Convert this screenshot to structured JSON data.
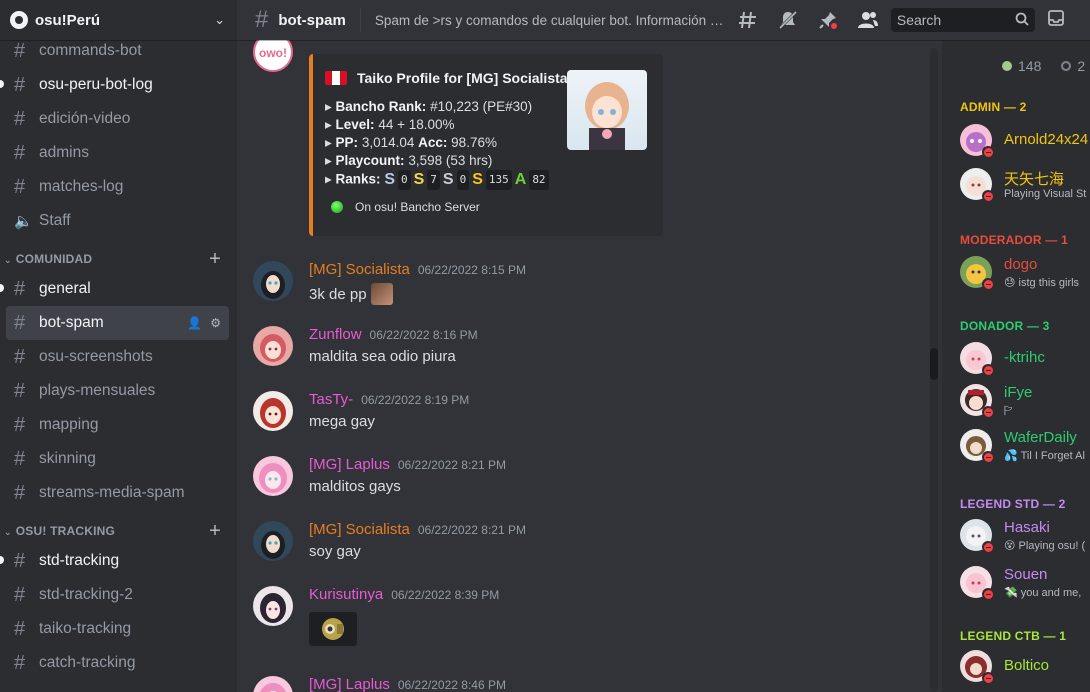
{
  "server": {
    "name": "osu!Perú"
  },
  "channels_top": [
    {
      "label": "commands-bot",
      "unread": false,
      "type": "text"
    },
    {
      "label": "osu-peru-bot-log",
      "unread": true,
      "type": "text"
    },
    {
      "label": "edición-video",
      "unread": false,
      "type": "text"
    },
    {
      "label": "admins",
      "unread": false,
      "type": "text"
    },
    {
      "label": "matches-log",
      "unread": false,
      "type": "text"
    },
    {
      "label": "Staff",
      "unread": false,
      "type": "voice"
    }
  ],
  "category_comunidad": "COMUNIDAD",
  "channels_comunidad": [
    {
      "label": "general",
      "unread": true
    },
    {
      "label": "bot-spam",
      "active": true
    },
    {
      "label": "osu-screenshots"
    },
    {
      "label": "plays-mensuales"
    },
    {
      "label": "mapping"
    },
    {
      "label": "skinning"
    },
    {
      "label": "streams-media-spam"
    }
  ],
  "category_tracking": "OSU! TRACKING",
  "channels_tracking": [
    {
      "label": "std-tracking",
      "unread": true
    },
    {
      "label": "std-tracking-2"
    },
    {
      "label": "taiko-tracking"
    },
    {
      "label": "catch-tracking"
    }
  ],
  "topbar": {
    "channel": "bot-spam",
    "topic": "Spam de >rs y comandos de cualquier bot. Información a...",
    "search_placeholder": "Search"
  },
  "embed": {
    "title": "Taiko Profile for [MG] Socialista",
    "lines": [
      {
        "k": "Bancho Rank:",
        "v": "#10,223 (PE#30)"
      },
      {
        "k": "Level:",
        "v": "44 + 18.00%"
      },
      {
        "k": "PP:",
        "v": "3,014.04",
        "k2": "Acc:",
        "v2": "98.76%"
      },
      {
        "k": "Playcount:",
        "v": "3,598 (53 hrs)"
      }
    ],
    "ranks_label": "Ranks:",
    "ranks": [
      {
        "g": "S",
        "c": "#b9c7e3",
        "v": "0"
      },
      {
        "g": "S",
        "c": "#f5d742",
        "v": "7"
      },
      {
        "g": "S",
        "c": "#c8ced8",
        "v": "0"
      },
      {
        "g": "S",
        "c": "#f5c518",
        "v": "135"
      },
      {
        "g": "A",
        "c": "#6fd13a",
        "v": "82"
      }
    ],
    "footer": "On osu! Bancho Server",
    "accent": "#e67e22"
  },
  "messages": [
    {
      "author": "[MG] Socialista",
      "color": "#e67e22",
      "time": "06/22/2022 8:15 PM",
      "text": "3k de pp",
      "emoji": true
    },
    {
      "author": "Zunflow",
      "color": "#e95ad4",
      "time": "06/22/2022 8:16 PM",
      "text": "maldita sea odio piura"
    },
    {
      "author": "TasTy-",
      "color": "#e95ad4",
      "time": "06/22/2022 8:19 PM",
      "text": "mega gay"
    },
    {
      "author": "[MG] Laplus",
      "color": "#e95ad4",
      "time": "06/22/2022 8:21 PM",
      "text": "malditos gays"
    },
    {
      "author": "[MG] Socialista",
      "color": "#e67e22",
      "time": "06/22/2022 8:21 PM",
      "text": "soy gay"
    },
    {
      "author": "Kurisutinya",
      "color": "#e95ad4",
      "time": "06/22/2022 8:39 PM",
      "text": ""
    },
    {
      "author": "[MG] Laplus",
      "color": "#e95ad4",
      "time": "06/22/2022 8:46 PM",
      "text": ""
    }
  ],
  "member_counts": {
    "online": "148",
    "offline": "2"
  },
  "roles": [
    {
      "label": "ADMIN — 2",
      "color": "#f1c40f"
    },
    {
      "label": "MODERADOR — 1",
      "color": "#e74c3c"
    },
    {
      "label": "DONADOR — 3",
      "color": "#2ecc71"
    },
    {
      "label": "LEGEND STD — 2",
      "color": "#c48bf0"
    },
    {
      "label": "LEGEND CTB — 1",
      "color": "#a8e63a"
    }
  ],
  "members": [
    {
      "name": "Arnold24x24",
      "color": "#f1c40f",
      "activity": ""
    },
    {
      "name": "天矢七海",
      "color": "#f1c40f",
      "activity": "Playing Visual St"
    },
    {
      "name": "dogo",
      "color": "#e74c3c",
      "activity": "istg this girls"
    },
    {
      "name": "-ktrihc",
      "color": "#2ecc71",
      "activity": ""
    },
    {
      "name": "iFye",
      "color": "#2ecc71",
      "activity": ""
    },
    {
      "name": "WaferDaily",
      "color": "#2ecc71",
      "activity": "Til I Forget Al"
    },
    {
      "name": "Hasaki",
      "color": "#c48bf0",
      "activity": "Playing osu! ("
    },
    {
      "name": "Souen",
      "color": "#c48bf0",
      "activity": "you and me,"
    },
    {
      "name": "Boltico",
      "color": "#a8e63a",
      "activity": ""
    }
  ]
}
